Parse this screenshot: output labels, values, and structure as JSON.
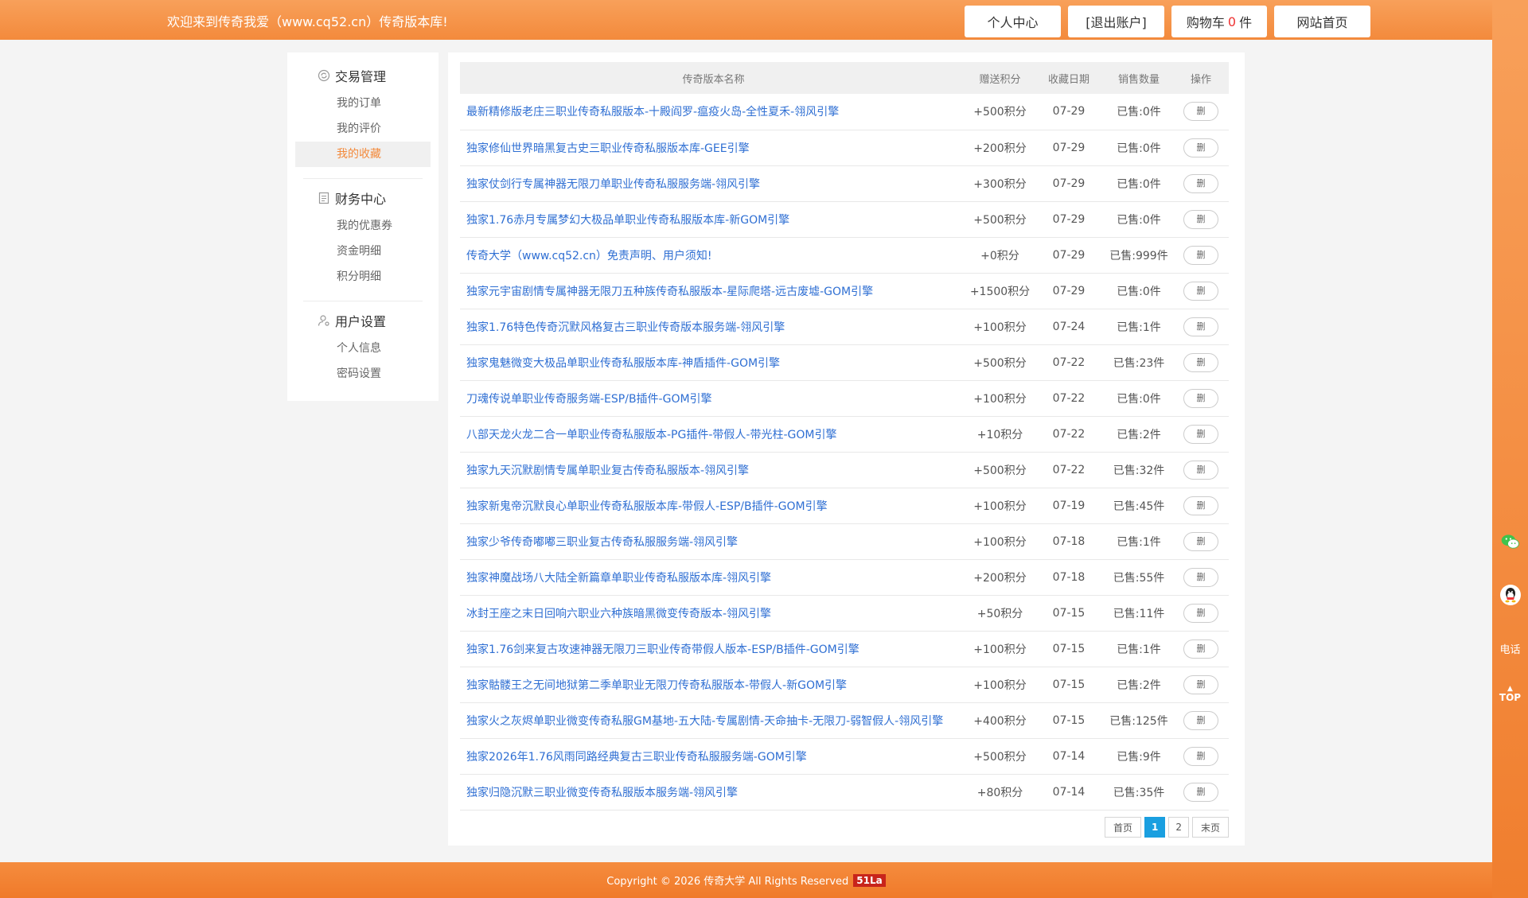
{
  "header": {
    "welcome": "欢迎来到传奇我爱（www.cq52.cn）传奇版本库!",
    "nav": {
      "personal_center": "个人中心",
      "logout": "[退出账户]",
      "cart_label": "购物车",
      "cart_count": "0",
      "cart_unit": "件",
      "home": "网站首页"
    }
  },
  "sidebar": {
    "groups": [
      {
        "title": "交易管理",
        "icon": "refresh-circle-icon",
        "items": [
          "我的订单",
          "我的评价",
          "我的收藏"
        ]
      },
      {
        "title": "财务中心",
        "icon": "document-icon",
        "items": [
          "我的优惠券",
          "资金明细",
          "积分明细"
        ]
      },
      {
        "title": "用户设置",
        "icon": "user-gear-icon",
        "items": [
          "个人信息",
          "密码设置"
        ]
      }
    ],
    "active_item": "我的收藏"
  },
  "table": {
    "headers": [
      "传奇版本名称",
      "赠送积分",
      "收藏日期",
      "销售数量",
      "操作"
    ],
    "delete_label": "删",
    "rows": [
      {
        "name": "最新精修版老庄三职业传奇私服版本-十殿阎罗-瘟疫火岛-全性夏禾-翎风引擎",
        "points": "+500积分",
        "date": "07-29",
        "sold": "已售:0件"
      },
      {
        "name": "独家修仙世界暗黑复古史三职业传奇私服版本库-GEE引擎",
        "points": "+200积分",
        "date": "07-29",
        "sold": "已售:0件"
      },
      {
        "name": "独家仗剑行专属神器无限刀单职业传奇私服服务端-翎风引擎",
        "points": "+300积分",
        "date": "07-29",
        "sold": "已售:0件"
      },
      {
        "name": "独家1.76赤月专属梦幻大极品单职业传奇私服版本库-新GOM引擎",
        "points": "+500积分",
        "date": "07-29",
        "sold": "已售:0件"
      },
      {
        "name": "传奇大学（www.cq52.cn）免责声明、用户须知!",
        "points": "+0积分",
        "date": "07-29",
        "sold": "已售:999件"
      },
      {
        "name": "独家元宇宙剧情专属神器无限刀五种族传奇私服版本-星际爬塔-远古废墟-GOM引擎",
        "points": "+1500积分",
        "date": "07-29",
        "sold": "已售:0件"
      },
      {
        "name": "独家1.76特色传奇沉默风格复古三职业传奇版本服务端-翎风引擎",
        "points": "+100积分",
        "date": "07-24",
        "sold": "已售:1件"
      },
      {
        "name": "独家鬼魅微变大极品单职业传奇私服版本库-神盾插件-GOM引擎",
        "points": "+500积分",
        "date": "07-22",
        "sold": "已售:23件"
      },
      {
        "name": "刀魂传说单职业传奇服务端-ESP/B插件-GOM引擎",
        "points": "+100积分",
        "date": "07-22",
        "sold": "已售:0件"
      },
      {
        "name": "八部天龙火龙二合一单职业传奇私服版本-PG插件-带假人-带光柱-GOM引擎",
        "points": "+10积分",
        "date": "07-22",
        "sold": "已售:2件"
      },
      {
        "name": "独家九天沉默剧情专属单职业复古传奇私服版本-翎风引擎",
        "points": "+500积分",
        "date": "07-22",
        "sold": "已售:32件"
      },
      {
        "name": "独家新鬼帝沉默良心单职业传奇私服版本库-带假人-ESP/B插件-GOM引擎",
        "points": "+100积分",
        "date": "07-19",
        "sold": "已售:45件"
      },
      {
        "name": "独家少爷传奇嘟嘟三职业复古传奇私服服务端-翎风引擎",
        "points": "+100积分",
        "date": "07-18",
        "sold": "已售:1件"
      },
      {
        "name": "独家神魔战场八大陆全新篇章单职业传奇私服版本库-翎风引擎",
        "points": "+200积分",
        "date": "07-18",
        "sold": "已售:55件"
      },
      {
        "name": "冰封王座之末日回响六职业六种族暗黑微变传奇版本-翎风引擎",
        "points": "+50积分",
        "date": "07-15",
        "sold": "已售:11件"
      },
      {
        "name": "独家1.76剑来复古攻速神器无限刀三职业传奇带假人版本-ESP/B插件-GOM引擎",
        "points": "+100积分",
        "date": "07-15",
        "sold": "已售:1件"
      },
      {
        "name": "独家骷髅王之无间地狱第二季单职业无限刀传奇私服版本-带假人-新GOM引擎",
        "points": "+100积分",
        "date": "07-15",
        "sold": "已售:2件"
      },
      {
        "name": "独家火之灰烬单职业微变传奇私服GM基地-五大陆-专属剧情-天命抽卡-无限刀-弱智假人-翎风引擎",
        "points": "+400积分",
        "date": "07-15",
        "sold": "已售:125件"
      },
      {
        "name": "独家2026年1.76风雨同路经典复古三职业传奇私服服务端-GOM引擎",
        "points": "+500积分",
        "date": "07-14",
        "sold": "已售:9件"
      },
      {
        "name": "独家归隐沉默三职业微变传奇私服版本服务端-翎风引擎",
        "points": "+80积分",
        "date": "07-14",
        "sold": "已售:35件"
      }
    ]
  },
  "pager": {
    "first": "首页",
    "page1": "1",
    "page2": "2",
    "last": "末页"
  },
  "rightbar": {
    "phone": "电话",
    "top": "TOP",
    "icons": [
      "wechat-icon",
      "qq-icon"
    ]
  },
  "footer": {
    "copyright": "Copyright © 2026 传奇大学 All Rights Reserved",
    "badge": "51La"
  },
  "colors": {
    "accent": "#f38a3c",
    "link": "#2f6fd3",
    "pager_active": "#1a9fe0"
  }
}
